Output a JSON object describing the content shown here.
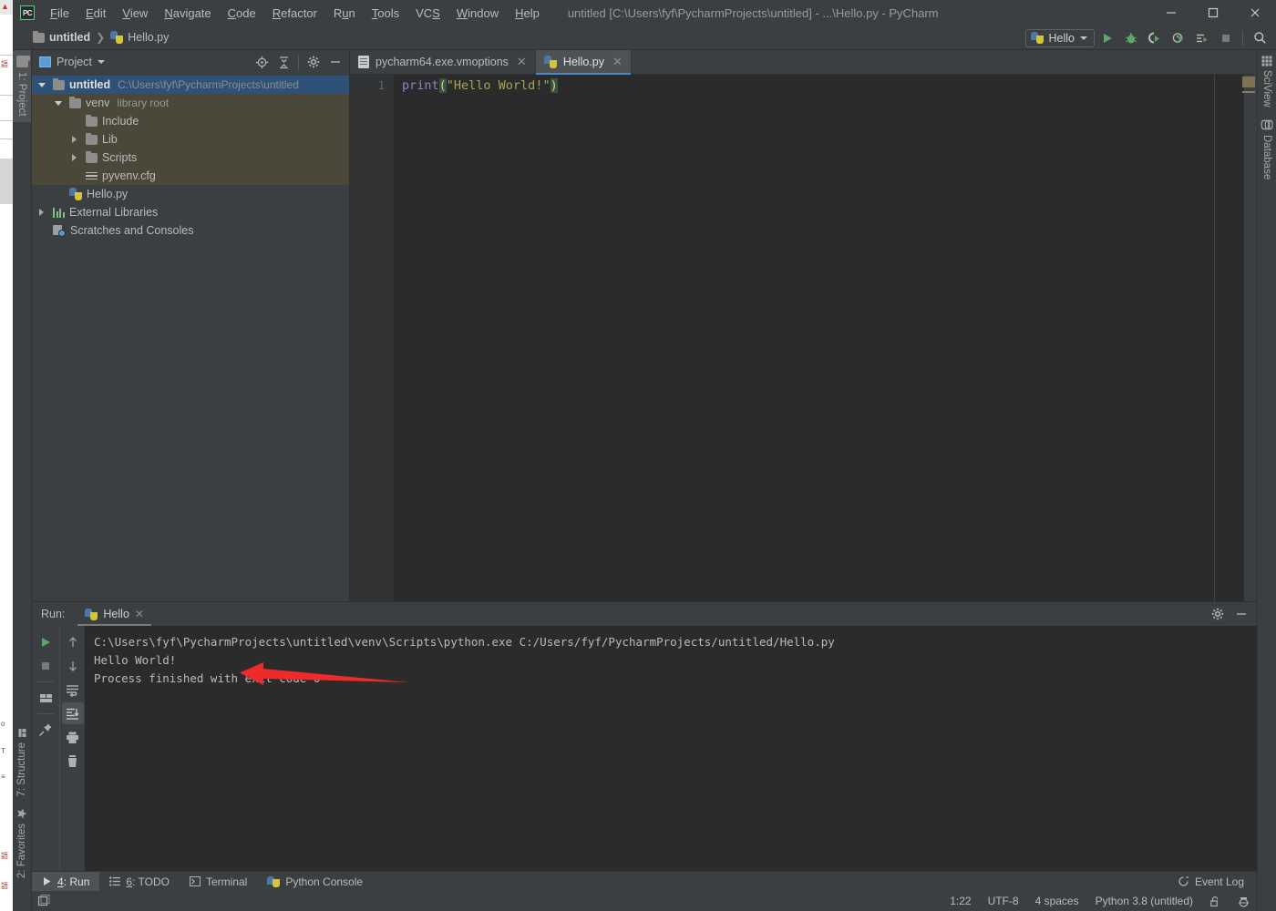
{
  "window": {
    "title": "untitled [C:\\Users\\fyf\\PycharmProjects\\untitled] - ...\\Hello.py - PyCharm",
    "logo_text": "PC",
    "controls": {
      "minimize": "minimize-button",
      "maximize": "maximize-button",
      "close": "close-button"
    }
  },
  "menubar": {
    "items": [
      {
        "label": "File",
        "mnemonic": "F"
      },
      {
        "label": "Edit",
        "mnemonic": "E"
      },
      {
        "label": "View",
        "mnemonic": "V"
      },
      {
        "label": "Navigate",
        "mnemonic": "N"
      },
      {
        "label": "Code",
        "mnemonic": "C"
      },
      {
        "label": "Refactor",
        "mnemonic": "R"
      },
      {
        "label": "Run",
        "mnemonic": "u"
      },
      {
        "label": "Tools",
        "mnemonic": "T"
      },
      {
        "label": "VCS",
        "mnemonic": "S"
      },
      {
        "label": "Window",
        "mnemonic": "W"
      },
      {
        "label": "Help",
        "mnemonic": "H"
      }
    ]
  },
  "navbar": {
    "breadcrumbs": [
      {
        "label": "untitled",
        "icon": "folder-icon"
      },
      {
        "label": "Hello.py",
        "icon": "python-file-icon"
      }
    ],
    "run_config": {
      "label": "Hello",
      "icon": "python-icon"
    },
    "buttons": [
      {
        "name": "run-button",
        "glyph": "run"
      },
      {
        "name": "debug-button",
        "glyph": "debug"
      },
      {
        "name": "run-with-coverage-button",
        "glyph": "coverage"
      },
      {
        "name": "profile-button",
        "glyph": "profile"
      },
      {
        "name": "run-dashboard-button",
        "glyph": "dashboard"
      },
      {
        "name": "stop-button",
        "glyph": "stop"
      },
      {
        "name": "search-everywhere-button",
        "glyph": "search"
      }
    ]
  },
  "left_strip": {
    "tabs": [
      {
        "label": "1: Project",
        "icon": "folder-icon",
        "active": true
      },
      {
        "label": "7: Structure",
        "icon": "structure-icon",
        "active": false
      },
      {
        "label": "2: Favorites",
        "icon": "star-icon",
        "active": false
      }
    ]
  },
  "right_strip": {
    "tabs": [
      {
        "label": "SciView",
        "icon": "grid-icon"
      },
      {
        "label": "Database",
        "icon": "database-icon"
      }
    ]
  },
  "project_pane": {
    "title": "Project",
    "header_buttons": [
      {
        "name": "scroll-from-source-button",
        "glyph": "target"
      },
      {
        "name": "collapse-all-button",
        "glyph": "collapse"
      },
      {
        "name": "settings-gear-button",
        "glyph": "gear"
      },
      {
        "name": "hide-panel-button",
        "glyph": "minus"
      }
    ],
    "tree": [
      {
        "label": "untitled",
        "sub": "C:\\Users\\fyf\\PycharmProjects\\untitled",
        "icon": "folder-icon",
        "indent": 0,
        "arrow": "down",
        "selected": true,
        "bold": true
      },
      {
        "label": "venv",
        "sub": "library root",
        "icon": "folder-icon",
        "indent": 1,
        "arrow": "down",
        "highlight": true
      },
      {
        "label": "Include",
        "sub": "",
        "icon": "folder-icon",
        "indent": 2,
        "arrow": "none",
        "highlight": true
      },
      {
        "label": "Lib",
        "sub": "",
        "icon": "folder-icon",
        "indent": 2,
        "arrow": "right",
        "highlight": true
      },
      {
        "label": "Scripts",
        "sub": "",
        "icon": "folder-icon",
        "indent": 2,
        "arrow": "right",
        "highlight": true
      },
      {
        "label": "pyvenv.cfg",
        "sub": "",
        "icon": "config-file-icon",
        "indent": 2,
        "arrow": "none",
        "highlight": true
      },
      {
        "label": "Hello.py",
        "sub": "",
        "icon": "python-file-icon",
        "indent": 1,
        "arrow": "none"
      },
      {
        "label": "External Libraries",
        "sub": "",
        "icon": "library-icon",
        "indent": 0,
        "arrow": "right"
      },
      {
        "label": "Scratches and Consoles",
        "sub": "",
        "icon": "scratches-icon",
        "indent": 0,
        "arrow": "none"
      }
    ]
  },
  "editor": {
    "tabs": [
      {
        "label": "pycharm64.exe.vmoptions",
        "icon": "text-file-icon",
        "active": false
      },
      {
        "label": "Hello.py",
        "icon": "python-file-icon",
        "active": true
      }
    ],
    "line_numbers": [
      "1"
    ],
    "code": {
      "func": "print",
      "open_paren": "(",
      "string": "\"Hello World!\"",
      "close_paren": ")"
    },
    "colors": {
      "background": "#2b2b2b",
      "gutter": "#313335",
      "function": "#8888c6",
      "string": "#a5a55a",
      "paren": "#d8d84a"
    }
  },
  "run_pane": {
    "label": "Run:",
    "tab": {
      "label": "Hello",
      "icon": "python-icon"
    },
    "header_buttons": [
      {
        "name": "run-settings-button",
        "glyph": "gear"
      },
      {
        "name": "hide-run-panel-button",
        "glyph": "minus"
      }
    ],
    "sidebar_buttons": [
      {
        "name": "rerun-button",
        "glyph": "run"
      },
      {
        "name": "stop-process-button",
        "glyph": "stop"
      },
      {
        "name": "show-running-list-button",
        "glyph": "windows"
      },
      {
        "name": "pin-tab-button",
        "glyph": "pin"
      },
      {
        "name": "up-stack-button",
        "glyph": "arrow-up"
      },
      {
        "name": "down-stack-button",
        "glyph": "arrow-down"
      },
      {
        "name": "soft-wrap-button",
        "glyph": "wrap"
      },
      {
        "name": "scroll-to-end-button",
        "glyph": "scroll-end",
        "active": true
      },
      {
        "name": "print-button",
        "glyph": "printer"
      },
      {
        "name": "clear-all-button",
        "glyph": "trash"
      }
    ],
    "console_lines": [
      "C:\\Users\\fyf\\PycharmProjects\\untitled\\venv\\Scripts\\python.exe C:/Users/fyf/PycharmProjects/untitled/Hello.py",
      "Hello World!",
      "",
      "Process finished with exit code 0"
    ],
    "annotation": {
      "type": "red-arrow",
      "color": "#ee2b2b",
      "points_at": "Hello World!"
    }
  },
  "bottom_bar": {
    "items": [
      {
        "label": "4: Run",
        "mnemonic": "4",
        "icon": "run-icon",
        "active": true
      },
      {
        "label": "6: TODO",
        "mnemonic": "6",
        "icon": "list-icon",
        "active": false
      },
      {
        "label": "Terminal",
        "mnemonic": "",
        "icon": "terminal-icon",
        "active": false
      },
      {
        "label": "Python Console",
        "mnemonic": "",
        "icon": "python-icon",
        "active": false
      }
    ]
  },
  "status_bar": {
    "event_log": "Event Log",
    "caret_position": "1:22",
    "encoding": "UTF-8",
    "indent": "4 spaces",
    "interpreter": "Python 3.8 (untitled)",
    "icons": [
      {
        "name": "lock-icon"
      },
      {
        "name": "inspector-icon"
      }
    ],
    "left_icon": "show-tool-windows-icon"
  }
}
